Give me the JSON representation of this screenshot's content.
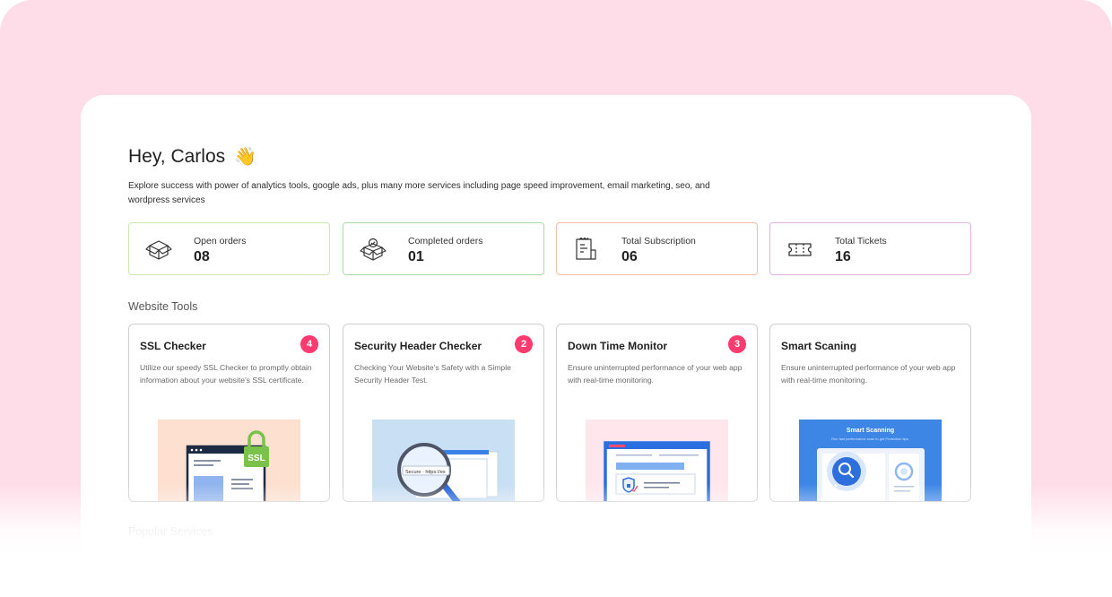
{
  "greeting": {
    "text": "Hey, Carlos",
    "emoji": "👋"
  },
  "intro": "Explore success with power of analytics tools, google ads, plus many more services including page speed improvement, email marketing, seo, and wordpress services",
  "stats": [
    {
      "label": "Open orders",
      "value": "08",
      "icon": "box-icon",
      "border": "#cfe6b0"
    },
    {
      "label": "Completed orders",
      "value": "01",
      "icon": "box-check-icon",
      "border": "#a9dba9"
    },
    {
      "label": "Total Subscription",
      "value": "06",
      "icon": "receipt-icon",
      "border": "#f5bda8"
    },
    {
      "label": "Total Tickets",
      "value": "16",
      "icon": "ticket-icon",
      "border": "#e0b3e0"
    }
  ],
  "tools_section_title": "Website Tools",
  "tools": [
    {
      "title": "SSL Checker",
      "badge": "4",
      "desc": "Utilize our speedy SSL Checker to promptly obtain information about your website's SSL certificate.",
      "illus_bg": "#fde0cf",
      "illus_label": "SSL"
    },
    {
      "title": "Security Header Checker",
      "badge": "2",
      "desc": "Checking Your Website's Safety with a Simple Security Header Test.",
      "illus_bg": "#c9dff3",
      "illus_label": "Secure · https://ex"
    },
    {
      "title": "Down Time Monitor",
      "badge": "3",
      "desc": "Ensure uninterrupted performance of your web app with real-time monitoring.",
      "illus_bg": "#ffe6ec"
    },
    {
      "title": "Smart Scaning",
      "badge": "",
      "desc": "Ensure uninterrupted performance of your web app with real-time monitoring.",
      "illus_bg": "#3d86e6",
      "illus_label": "Smart Scanning",
      "illus_sub": "Run fast performance scan to get Protection tips."
    }
  ],
  "popular_section_title": "Popular Services",
  "colors": {
    "accent": "#ff3a6e",
    "page_bg": "#ffdde8"
  }
}
